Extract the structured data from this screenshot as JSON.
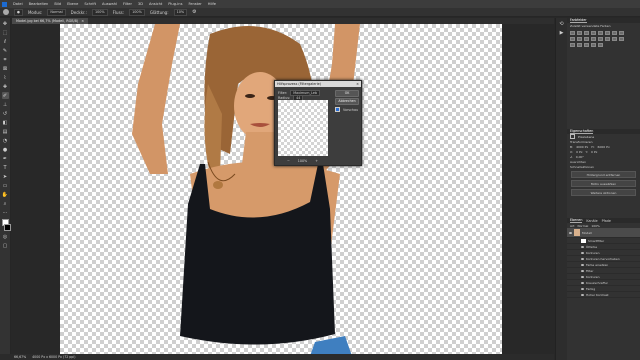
{
  "menu": [
    "Datei",
    "Bearbeiten",
    "Bild",
    "Ebene",
    "Schrift",
    "Auswahl",
    "Filter",
    "3D",
    "Ansicht",
    "Plug-ins",
    "Fenster",
    "Hilfe"
  ],
  "options": {
    "mode_label": "Modus:",
    "mode_value": "Normal",
    "opacity_label": "Deckkr.:",
    "opacity_value": "100%",
    "flow_label": "Fluss:",
    "flow_value": "100%",
    "smooth_label": "Glättung:",
    "smooth_value": "10%"
  },
  "document_tab": {
    "title": "Model.jpg bei 66,7% (Modell, RGB/8)",
    "close": "×"
  },
  "status": {
    "zoom": "66,67%",
    "info": "4000 Px x 6000 Px (72 ppi)"
  },
  "dialog": {
    "title": "Hilfsprozess (Filtergalerie)",
    "close": "×",
    "filter_label": "Filter:",
    "filter_value": "Maximum_Leb",
    "radius_label": "Radius:",
    "radius_value": "44",
    "ok": "OK",
    "cancel": "Abbrechen",
    "preview_label": "Vorschau",
    "zoom_minus": "−",
    "zoom_value": "100%",
    "zoom_plus": "+"
  },
  "right_panel": {
    "swatches_tab": "Farbfelder",
    "swatches_sub": "Zuletzt verwendete Farben",
    "properties_tab": "Eigenschaften",
    "properties_type": "Pixelebene",
    "transform_label": "Transformieren",
    "b_label": "B:",
    "b_value": "4000 Px",
    "h_label": "H:",
    "h_value": "6000 Px",
    "x_label": "X:",
    "x_value": "0 Px",
    "y_label": "Y:",
    "y_value": "0 Px",
    "angle_value": "0,00°",
    "align_label": "Ausrichten",
    "quick_label": "Schnellaktionen",
    "btn_remove_bg": "Hintergrund entfernen",
    "btn_select_subject": "Motiv auswählen",
    "btn_more": "Weitere Aktionen",
    "layers_tabs": [
      "Ebenen",
      "Kanäle",
      "Pfade"
    ],
    "layer_kind": "Art",
    "layer_mode": "Normal",
    "layer_opacity": "100%",
    "layers": [
      {
        "name": "Modell"
      },
      {
        "name": "Smartfilter"
      },
      {
        "name": "Ölfarbe"
      },
      {
        "name": "Konturen"
      },
      {
        "name": "Konturen hervorheben"
      },
      {
        "name": "Farbe ersetzen"
      },
      {
        "name": "Filter"
      },
      {
        "name": "Konturen"
      },
      {
        "name": "Kreuzschraffur"
      },
      {
        "name": "Farbig"
      },
      {
        "name": "Hoher Kontrast"
      }
    ]
  },
  "colors": {
    "tank_top": "#14161b",
    "skin": "#c98a5a",
    "hair": "#8a5a2c",
    "jeans": "#3f7fc0"
  }
}
